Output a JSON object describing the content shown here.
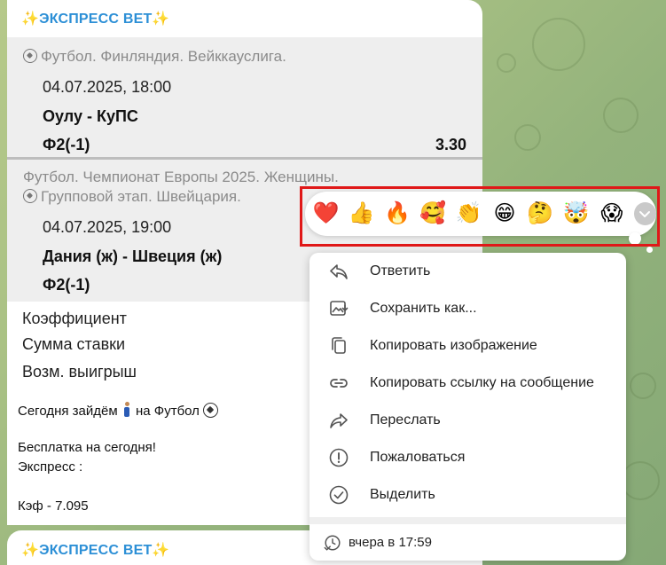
{
  "chat": {
    "sender": "ЭКСПРЕСС ВЕТ",
    "spark": "✨"
  },
  "bets": [
    {
      "league": "Футбол. Финляндия. Вейккауслига.",
      "league_line2": "",
      "datetime": "04.07.2025, 18:00",
      "match": "Оулу - КуПС",
      "pick": "Ф2(-1)",
      "odd": "3.30"
    },
    {
      "league": "Футбол. Чемпионат Европы 2025. Женщины.",
      "league_line2": "Групповой этап. Швейцария.",
      "datetime": "04.07.2025, 19:00",
      "match": "Дания (ж) - Швеция (ж)",
      "pick": "Ф2(-1)",
      "odd": ""
    }
  ],
  "summary": {
    "coef_label": "Коэффициент",
    "stake_label": "Сумма ставки",
    "win_label": "Возм. выигрыш"
  },
  "message": {
    "line1_before": "Сегодня зайдём",
    "line1_after": "на Футбол",
    "line2": "Бесплатка на сегодня!",
    "line3": "Экспресс :",
    "line4": "Кэф - 7.095"
  },
  "reactions": [
    {
      "name": "heart",
      "glyph": "❤️"
    },
    {
      "name": "thumbs-up",
      "glyph": "👍"
    },
    {
      "name": "fire",
      "glyph": "🔥"
    },
    {
      "name": "smiling-face-with-hearts",
      "glyph": "🥰"
    },
    {
      "name": "clapping-hands",
      "glyph": "👏"
    },
    {
      "name": "grinning-face",
      "glyph": "😁"
    },
    {
      "name": "thinking-face",
      "glyph": "🤔"
    },
    {
      "name": "exploding-head",
      "glyph": "🤯"
    },
    {
      "name": "screaming-face",
      "glyph": "😱"
    }
  ],
  "menu": {
    "items": [
      {
        "label": "Ответить",
        "icon": "reply-icon"
      },
      {
        "label": "Сохранить как...",
        "icon": "save-image-icon"
      },
      {
        "label": "Копировать изображение",
        "icon": "copy-icon"
      },
      {
        "label": "Копировать ссылку на сообщение",
        "icon": "link-icon"
      },
      {
        "label": "Переслать",
        "icon": "forward-icon"
      },
      {
        "label": "Пожаловаться",
        "icon": "report-icon"
      },
      {
        "label": "Выделить",
        "icon": "select-icon"
      }
    ],
    "footer": "вчера в 17:59"
  },
  "colors": {
    "sender": "#2c8fd6",
    "highlight": "#e01818"
  }
}
